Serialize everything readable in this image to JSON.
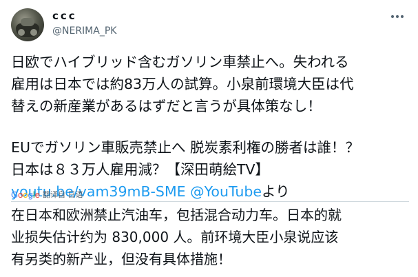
{
  "author": {
    "display_name": "ccc",
    "handle": "@NERIMA_PK"
  },
  "tweet": {
    "lines": [
      "日欧でハイブリッド含むガソリン車禁止へ。失われる",
      "雇用は日本では約83万人の試算。小泉前環境大臣は代",
      "替えの新産業があるはずだと言うが具体策なし！",
      "EUでガソリン車販売禁止へ 脱炭素利権の勝者は誰！？",
      "日本は８３万人雇用減？【深田萌絵TV】"
    ],
    "link_url": "youtu.be/vam39mB-SME",
    "link_mention": "@YouTube",
    "link_suffix": "より"
  },
  "translation": {
    "google_logo": "Google",
    "translate_label": "翻译自 日语",
    "lines": [
      "在日本和欧洲禁止汽油车，包括混合动力车。日本的就",
      "业损失估计约为 830,000 人。前环境大臣小泉说应该",
      "有另类的新产业，但没有具体措施！"
    ]
  },
  "icons": {
    "more": "more-horizontal-icon",
    "avatar": "avatar-image"
  }
}
